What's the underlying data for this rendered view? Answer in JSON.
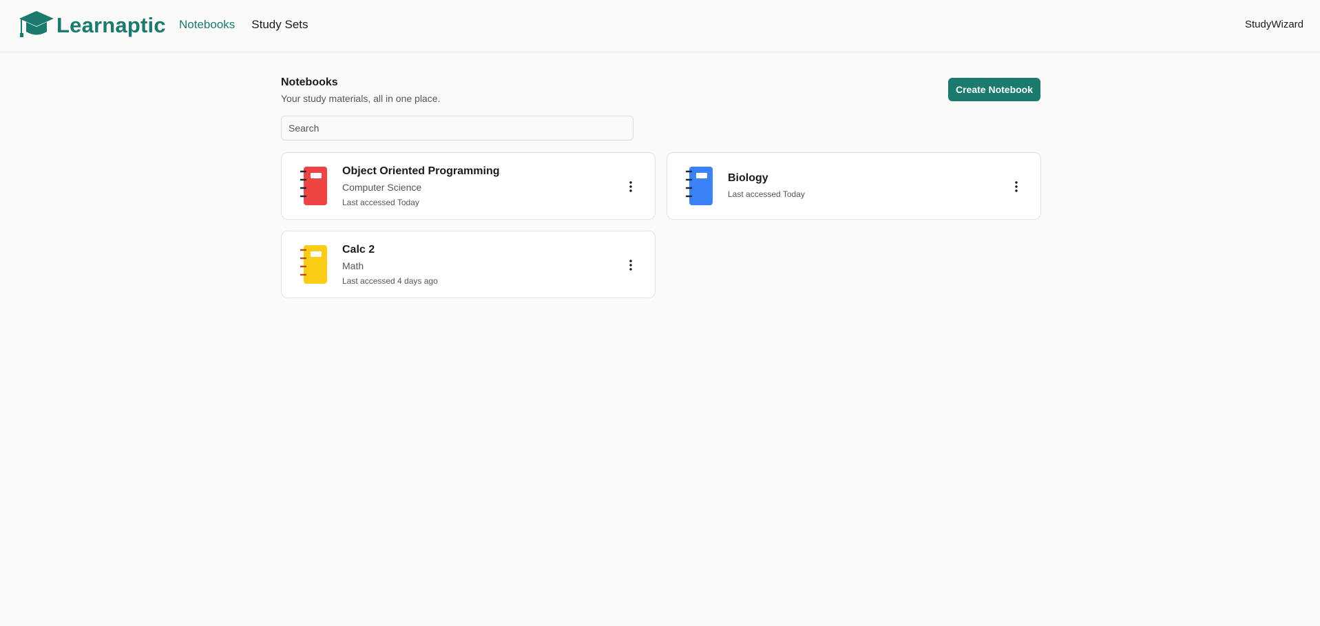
{
  "app": {
    "name": "Learnaptic",
    "brand_color": "#1a7a6e"
  },
  "nav": {
    "items": [
      {
        "label": "Notebooks",
        "active": true
      },
      {
        "label": "Study Sets",
        "active": false
      }
    ]
  },
  "user": {
    "name": "StudyWizard"
  },
  "page": {
    "title": "Notebooks",
    "subtitle": "Your study materials, all in one place.",
    "create_label": "Create Notebook"
  },
  "search": {
    "placeholder": "Search",
    "value": ""
  },
  "notebooks": [
    {
      "title": "Object Oriented Programming",
      "subject": "Computer Science",
      "accessed": "Last accessed Today",
      "color": "#ef4444",
      "icon": "notebook-icon",
      "menu_icon": "more-vertical-icon"
    },
    {
      "title": "Biology",
      "subject": "",
      "accessed": "Last accessed Today",
      "color": "#3b82f6",
      "icon": "notebook-icon",
      "menu_icon": "more-vertical-icon"
    },
    {
      "title": "Calc 2",
      "subject": "Math",
      "accessed": "Last accessed 4 days ago",
      "color": "#facc15",
      "icon": "notebook-icon",
      "menu_icon": "more-vertical-icon"
    }
  ]
}
